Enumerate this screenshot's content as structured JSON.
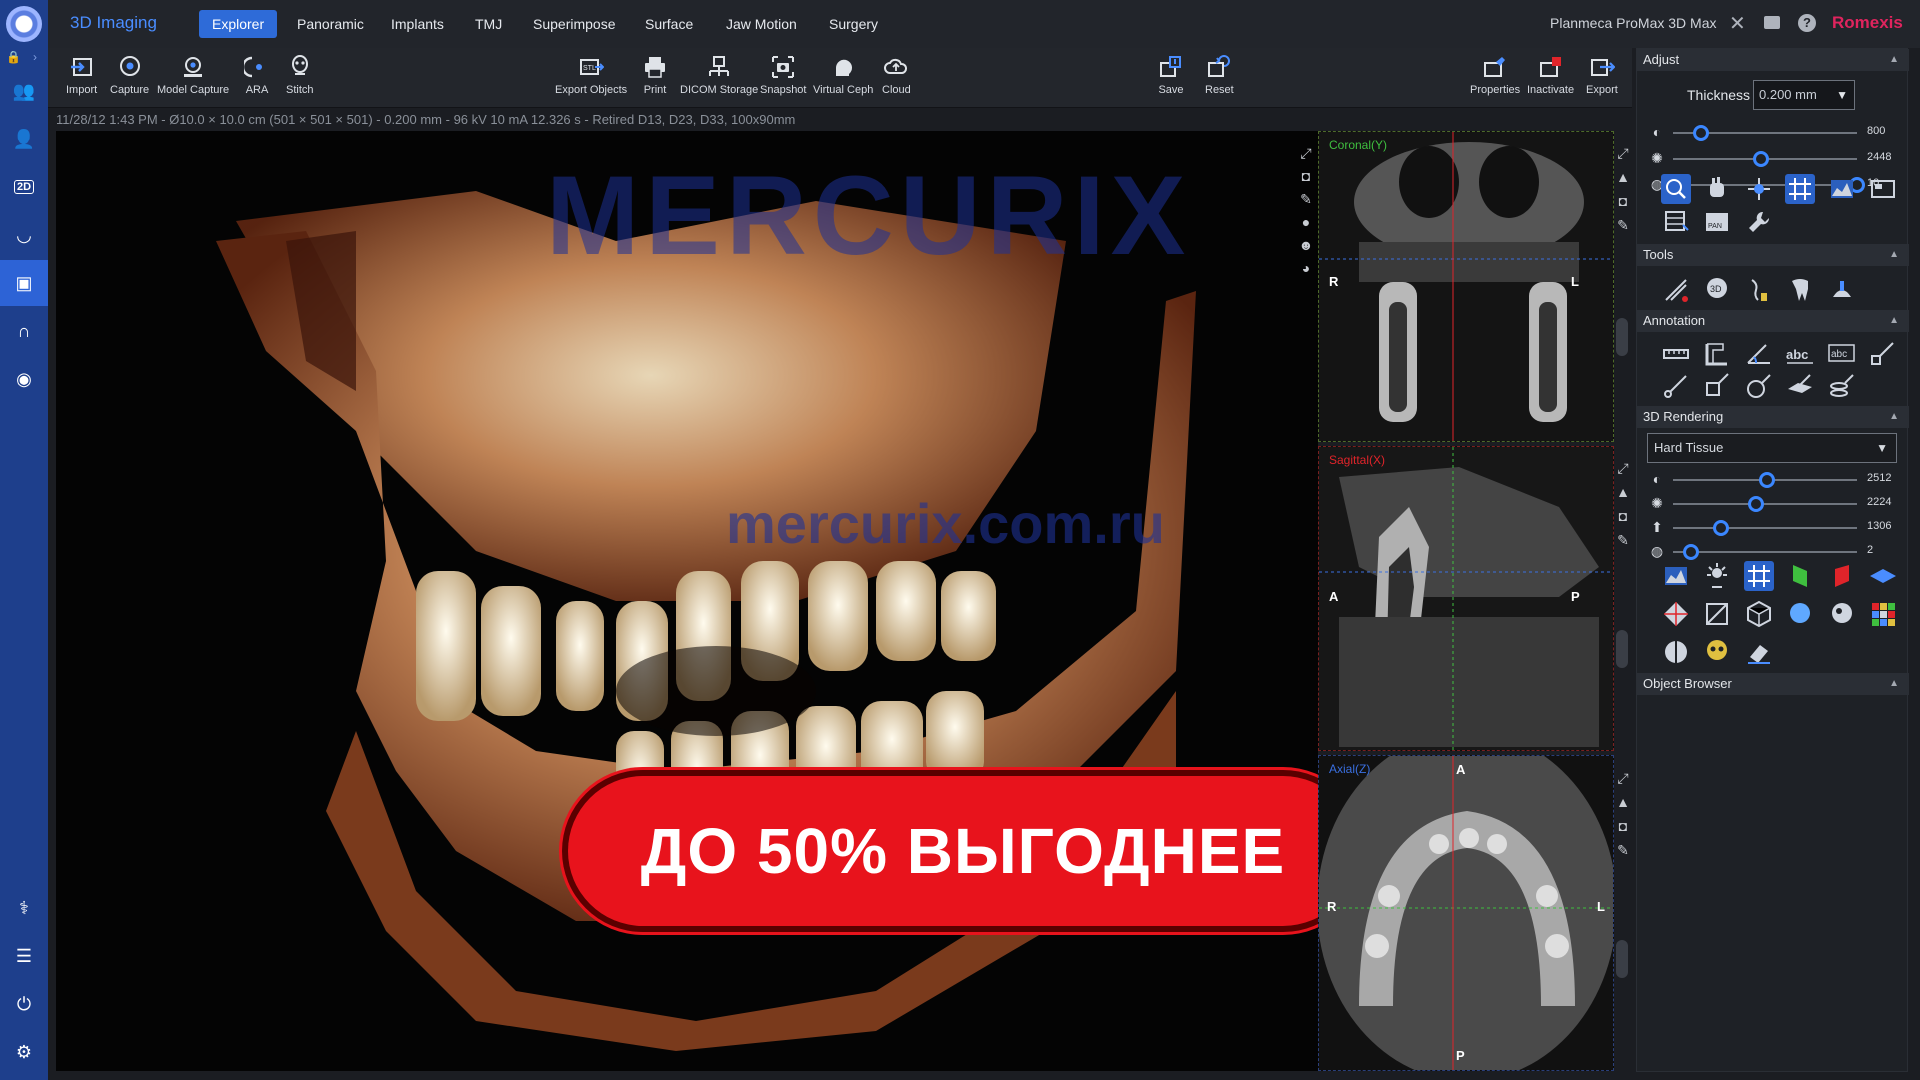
{
  "app": {
    "title": "3D Imaging",
    "device": "Planmeca ProMax 3D Max",
    "brand": "Romexis"
  },
  "menu": {
    "tabs": [
      {
        "label": "Explorer",
        "active": true
      },
      {
        "label": "Panoramic"
      },
      {
        "label": "Implants"
      },
      {
        "label": "TMJ"
      },
      {
        "label": "Superimpose"
      },
      {
        "label": "Surface"
      },
      {
        "label": "Jaw Motion"
      },
      {
        "label": "Surgery"
      }
    ]
  },
  "toolbar": {
    "import": "Import",
    "capture": "Capture",
    "model_capture": "Model Capture",
    "ara": "ARA",
    "stitch": "Stitch",
    "export_objects": "Export Objects",
    "print": "Print",
    "dicom_storage": "DICOM Storage",
    "snapshot": "Snapshot",
    "virtual_ceph": "Virtual Ceph",
    "cloud": "Cloud",
    "save": "Save",
    "reset": "Reset",
    "properties": "Properties",
    "inactivate": "Inactivate",
    "export": "Export"
  },
  "status_line": "11/28/12 1:43 PM - Ø10.0 × 10.0 cm (501 × 501 × 501) - 0.200 mm - 96 kV 10 mA 12.326 s - Retired D13, D23, D33, 100x90mm",
  "viewport": {
    "watermark_logo": "MERCURIX",
    "watermark_url": "mercurix.com.ru",
    "promo": "ДО 50% ВЫГОДНЕЕ"
  },
  "slices": {
    "coronal": {
      "label": "Coronal(Y)",
      "left": "R",
      "right": "L",
      "color": "#3fbf3f"
    },
    "sagittal": {
      "label": "Sagittal(X)",
      "left": "A",
      "right": "P",
      "color": "#e0242a"
    },
    "axial": {
      "label": "Axial(Z)",
      "top": "A",
      "bottom": "P",
      "left": "R",
      "right": "L",
      "color": "#3a6fe0"
    }
  },
  "panel": {
    "adjust": {
      "title": "Adjust",
      "thickness_label": "Thickness",
      "thickness_value": "0.200 mm",
      "sliders": [
        {
          "icon": "contrast-icon",
          "value": "800",
          "level": 0.15
        },
        {
          "icon": "brightness-icon",
          "value": "2448",
          "level": 0.48
        },
        {
          "icon": "gamma-icon",
          "value": "10",
          "level": 1.0
        }
      ]
    },
    "tools": {
      "title": "Tools"
    },
    "annotation": {
      "title": "Annotation"
    },
    "rendering": {
      "title": "3D Rendering",
      "preset": "Hard Tissue",
      "sliders": [
        {
          "icon": "contrast-icon",
          "value": "2512",
          "level": 0.51
        },
        {
          "icon": "brightness-icon",
          "value": "2224",
          "level": 0.45
        },
        {
          "icon": "threshold-icon",
          "value": "1306",
          "level": 0.26
        },
        {
          "icon": "opacity-icon",
          "value": "2",
          "level": 0.1
        }
      ]
    },
    "object_browser": {
      "title": "Object Browser"
    }
  },
  "colors": {
    "accent": "#2e6bd8",
    "rail": "#1e3f8c",
    "brand": "#e0245e",
    "promo": "#e8131c"
  }
}
